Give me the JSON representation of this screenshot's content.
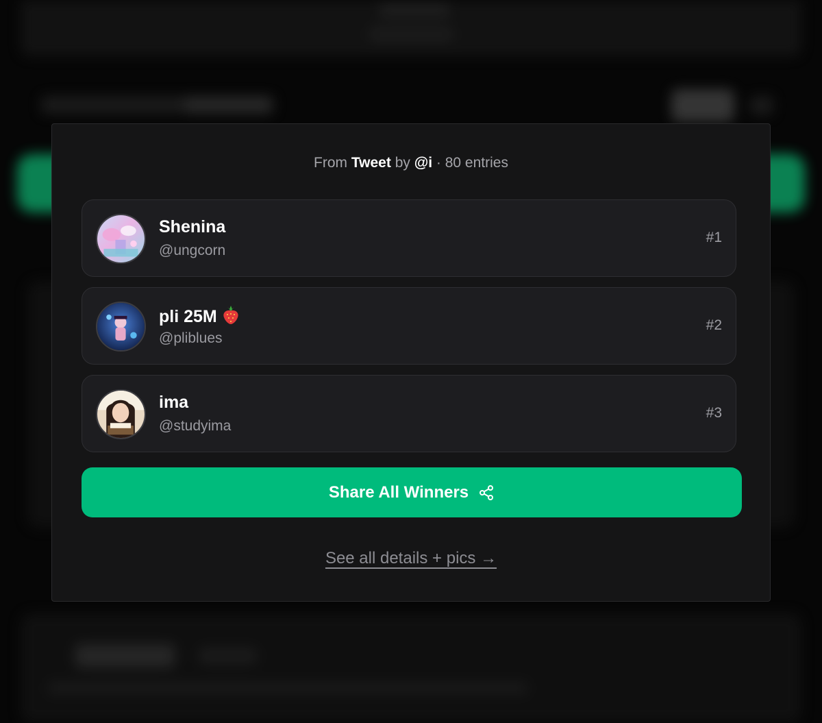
{
  "source": {
    "prefix": "From",
    "platform": "Tweet",
    "by_label": "by",
    "author": "@i",
    "entries_text": "· 80 entries"
  },
  "winners": [
    {
      "name": "Shenina",
      "handle": "@ungcorn",
      "rank": "#1",
      "avatar": "avatar-pastel-art"
    },
    {
      "name": "pli 25M",
      "handle": "@pliblues",
      "rank": "#2",
      "avatar": "avatar-blue-art",
      "emoji": "strawberry-icon"
    },
    {
      "name": "ima",
      "handle": "@studyima",
      "rank": "#3",
      "avatar": "avatar-girl-reading"
    }
  ],
  "share_button": {
    "label": "Share All Winners",
    "icon": "share-icon"
  },
  "details_link": {
    "label": "See all details + pics →"
  },
  "colors": {
    "accent": "#00bb7c",
    "modal_bg": "#151516",
    "card_bg": "#1d1d20"
  }
}
